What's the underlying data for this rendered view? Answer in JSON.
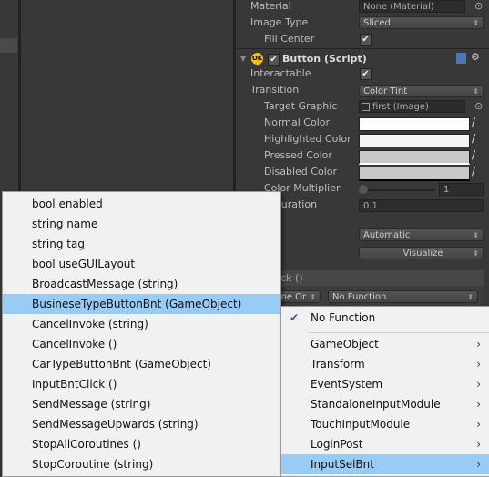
{
  "inspector": {
    "material_label": "Material",
    "material_value": "None (Material)",
    "image_type_label": "Image Type",
    "image_type_value": "Sliced",
    "fill_center_label": "Fill Center",
    "component_title": "Button (Script)",
    "component_badge": "OK",
    "interactable_label": "Interactable",
    "transition_label": "Transition",
    "transition_value": "Color Tint",
    "target_graphic_label": "Target Graphic",
    "target_graphic_value": "first (Image)",
    "normal_color_label": "Normal Color",
    "highlighted_color_label": "Highlighted Color",
    "pressed_color_label": "Pressed Color",
    "disabled_color_label": "Disabled Color",
    "color_multiplier_label": "Color Multiplier",
    "color_multiplier_value": "1",
    "fade_duration_label": "e Duration",
    "fade_duration_value": "0.1",
    "navigation_label": "ation",
    "navigation_value": "Automatic",
    "visualize_label": "Visualize",
    "onclick_label": "lick ()",
    "runtime_value": "me Or",
    "function_value": "No Function"
  },
  "colors": {
    "normal": "#ffffff",
    "highlighted": "#f5f5f5",
    "pressed": "#c8c8c8",
    "disabled": "#c8c8c8",
    "menu_highlight": "#99ccf5"
  },
  "left_menu": {
    "items": [
      {
        "label": "bool enabled"
      },
      {
        "label": "string name"
      },
      {
        "label": "string tag"
      },
      {
        "label": "bool useGUILayout"
      },
      {
        "label": "BroadcastMessage (string)"
      },
      {
        "label": "BusineseTypeButtonBnt (GameObject)",
        "selected": true
      },
      {
        "label": "CancelInvoke (string)"
      },
      {
        "label": "CancelInvoke ()"
      },
      {
        "label": "CarTypeButtonBnt (GameObject)"
      },
      {
        "label": "InputBntClick ()"
      },
      {
        "label": "SendMessage (string)"
      },
      {
        "label": "SendMessageUpwards (string)"
      },
      {
        "label": "StopAllCoroutines ()"
      },
      {
        "label": "StopCoroutine (string)"
      }
    ]
  },
  "right_menu": {
    "no_function": "No Function",
    "items": [
      {
        "label": "GameObject"
      },
      {
        "label": "Transform"
      },
      {
        "label": "EventSystem"
      },
      {
        "label": "StandaloneInputModule"
      },
      {
        "label": "TouchInputModule"
      },
      {
        "label": "LoginPost"
      },
      {
        "label": "InputSelBnt",
        "selected": true
      }
    ]
  }
}
